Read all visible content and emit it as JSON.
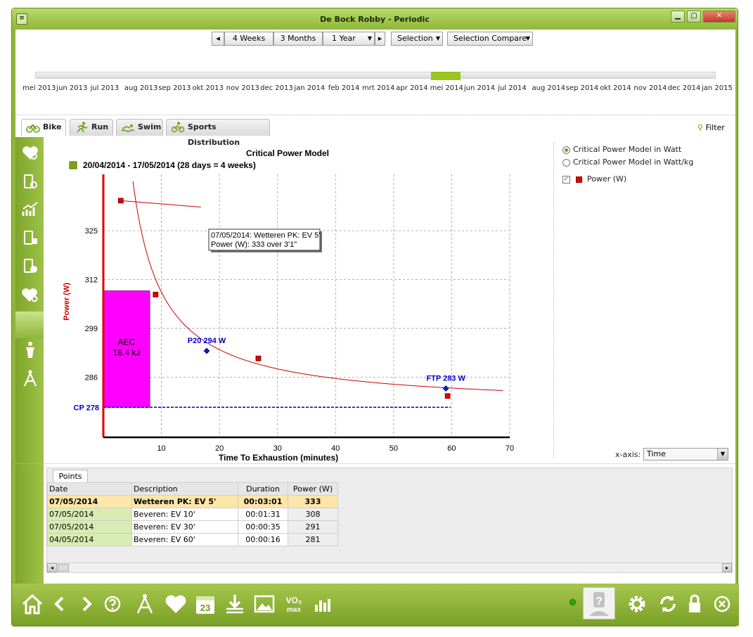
{
  "window": {
    "title": "De Bock Robby - Periodic"
  },
  "period": {
    "weeks4": "4 Weeks",
    "months3": "3 Months",
    "year1": "1 Year",
    "selection": "Selection",
    "selection_compare": "Selection Compare",
    "timeline_labels": [
      "mei 2013",
      "jun 2013",
      "jul 2013",
      "aug 2013",
      "sep 2013",
      "okt 2013",
      "nov 2013",
      "dec 2013",
      "jan 2014",
      "feb 2014",
      "mrt 2014",
      "apr 2014",
      "mei 2014",
      "jun 2014",
      "jul 2014",
      "aug 2014",
      "sep 2014",
      "okt 2014",
      "nov 2014",
      "dec 2014",
      "jan 2015"
    ]
  },
  "tabs": {
    "bike": "Bike",
    "run": "Run",
    "swim": "Swim",
    "sports_distribution": "Sports Distribution",
    "filter": "Filter"
  },
  "legend_options": {
    "cp_watt": "Critical Power Model in Watt",
    "cp_wattkg": "Critical Power Model in Watt/kg",
    "power": "Power (W)",
    "xaxis_label": "x-axis:",
    "xaxis_value": "Time"
  },
  "chart_data": {
    "type": "line",
    "title": "Critical Power Model",
    "period_label": "20/04/2014 - 17/05/2014 (28 days = 4 weeks)",
    "xlabel": "Time To Exhaustion (minutes)",
    "ylabel": "Power (W)",
    "xlim": [
      0,
      70
    ],
    "ylim": [
      270,
      340
    ],
    "x_ticks": [
      10,
      20,
      30,
      40,
      50,
      60,
      70
    ],
    "y_ticks": [
      286,
      299,
      312,
      325
    ],
    "cp": 278,
    "cp_label": "CP 278",
    "aec_label": "AEC",
    "aec_value": "18.4 kJ",
    "aec_to_minute": 8,
    "aec_top_power": 309,
    "curve": {
      "cp": 278,
      "wprime_j": 18400
    },
    "points": [
      {
        "x": 3.0,
        "y": 333
      },
      {
        "x": 9.0,
        "y": 308
      },
      {
        "x": 26.7,
        "y": 291
      },
      {
        "x": 59.3,
        "y": 281
      }
    ],
    "markers": [
      {
        "label": "P20 294 W",
        "x": 17.8,
        "y": 293
      },
      {
        "label": "FTP 283 W",
        "x": 59.0,
        "y": 283
      }
    ],
    "tooltip": {
      "line1": "07/05/2014: Wetteren PK: EV 5'",
      "line2": "Power (W): 333 over 3'1\""
    }
  },
  "points_panel": {
    "tab": "Points",
    "headers": [
      "Date",
      "Description",
      "Duration",
      "Power (W)"
    ],
    "rows": [
      [
        "07/05/2014",
        "Wetteren PK: EV 5'",
        "00:03:01",
        "333"
      ],
      [
        "07/05/2014",
        "Beveren: EV 10'",
        "00:01:31",
        "308"
      ],
      [
        "07/05/2014",
        "Beveren: EV 30'",
        "00:00:35",
        "291"
      ],
      [
        "04/05/2014",
        "Beveren: EV 60'",
        "00:00:16",
        "281"
      ]
    ]
  },
  "colors": {
    "brand_green": "#8fb63a",
    "selection_green": "#9ac41e",
    "aec_fill": "#ff00ff",
    "curve_red": "#cc0000",
    "cp_blue": "#0000cc"
  }
}
